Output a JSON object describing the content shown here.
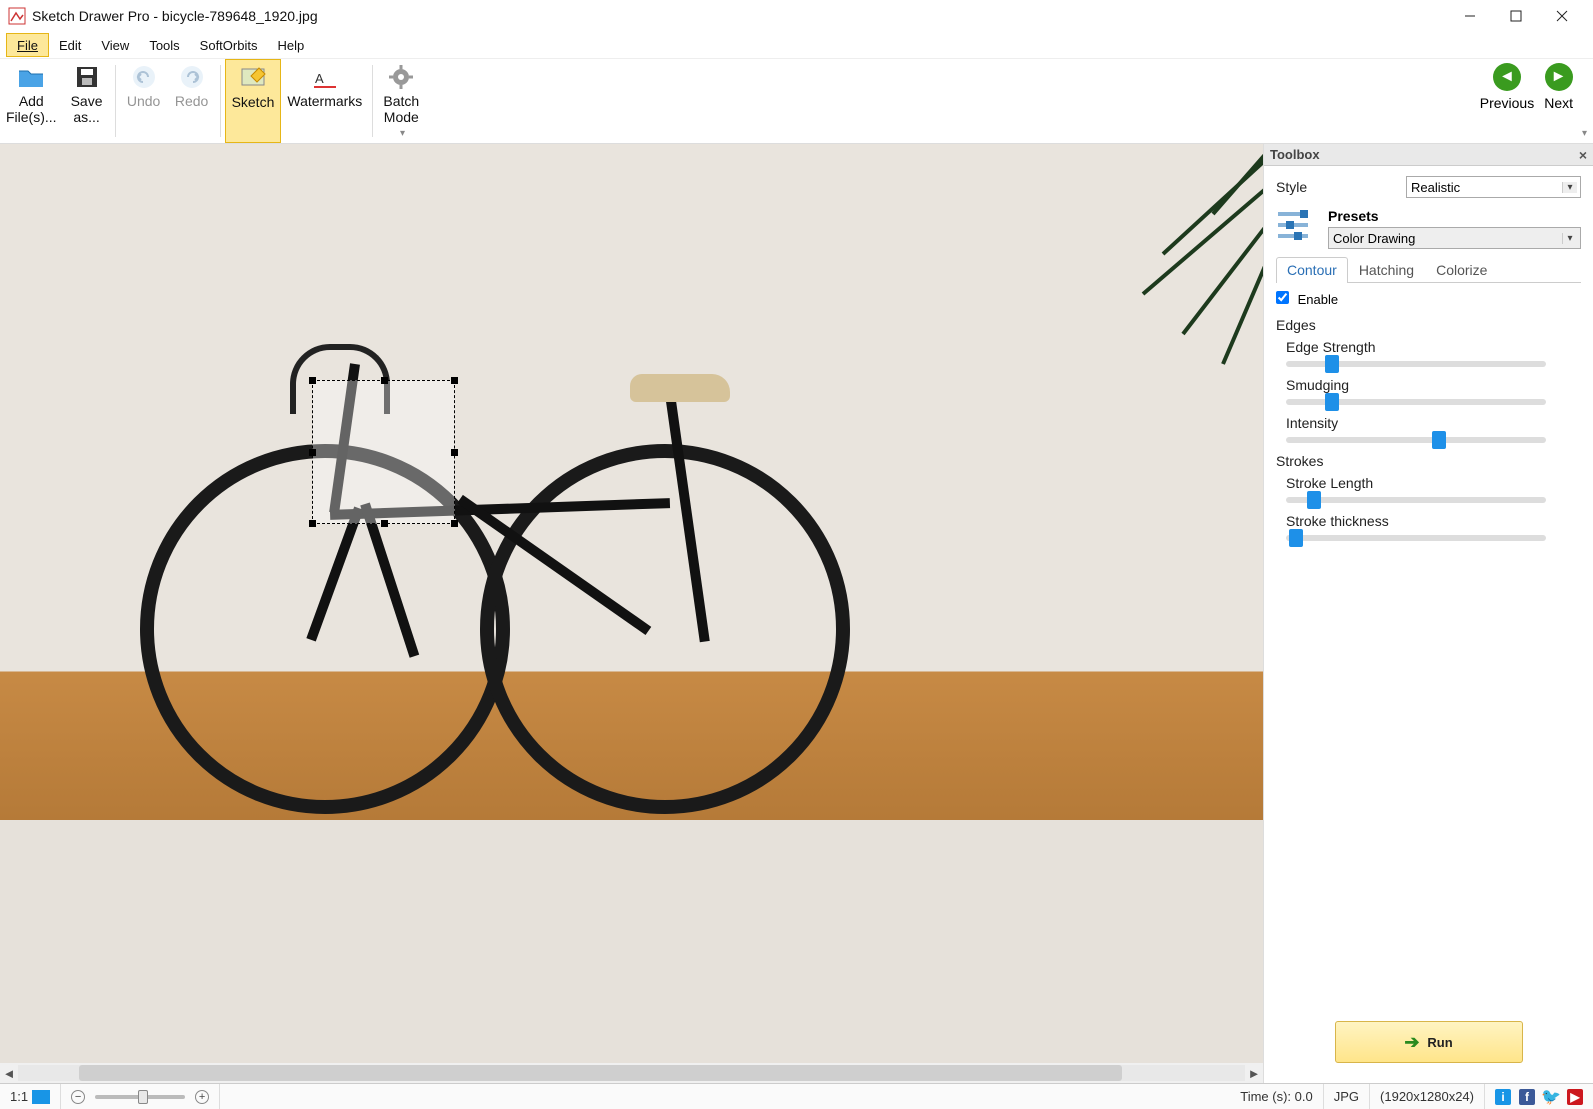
{
  "window": {
    "title": "Sketch Drawer Pro - bicycle-789648_1920.jpg"
  },
  "menu": {
    "file": "File",
    "edit": "Edit",
    "view": "View",
    "tools": "Tools",
    "softorbits": "SoftOrbits",
    "help": "Help"
  },
  "toolbar": {
    "add_files": "Add\nFile(s)...",
    "save_as": "Save\nas...",
    "undo": "Undo",
    "redo": "Redo",
    "sketch": "Sketch",
    "watermarks": "Watermarks",
    "batch_mode": "Batch\nMode",
    "previous": "Previous",
    "next": "Next"
  },
  "toolbox": {
    "title": "Toolbox",
    "style_label": "Style",
    "style_value": "Realistic",
    "presets_label": "Presets",
    "presets_value": "Color Drawing",
    "tabs": {
      "contour": "Contour",
      "hatching": "Hatching",
      "colorize": "Colorize"
    },
    "enable": "Enable",
    "edges_group": "Edges",
    "edge_strength": "Edge Strength",
    "smudging": "Smudging",
    "intensity": "Intensity",
    "strokes_group": "Strokes",
    "stroke_length": "Stroke Length",
    "stroke_thickness": "Stroke thickness",
    "sliders": {
      "edge_strength": 15,
      "smudging": 15,
      "intensity": 56,
      "stroke_length": 8,
      "stroke_thickness": 1
    },
    "run": "Run"
  },
  "status": {
    "ratio": "1:1",
    "time": "Time (s): 0.0",
    "format": "JPG",
    "dimensions": "(1920x1280x24)"
  }
}
